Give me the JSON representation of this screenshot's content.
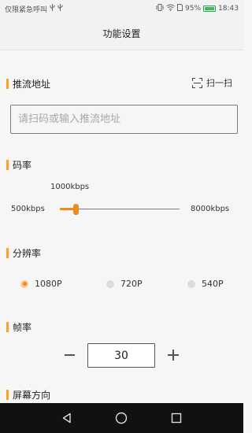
{
  "status_bar": {
    "carrier": "仅限紧急呼叫",
    "battery_percent": "95%",
    "time": "18:43",
    "colors": {
      "battery": "#33c05a"
    }
  },
  "header": {
    "title": "功能设置"
  },
  "push_url": {
    "title": "推流地址",
    "scan_label": "扫一扫",
    "placeholder": "请扫码或输入推流地址",
    "value": ""
  },
  "bitrate": {
    "title": "码率",
    "current_label": "1000kbps",
    "min_label": "500kbps",
    "max_label": "8000kbps",
    "value_kbps": 1000,
    "min_kbps": 500,
    "max_kbps": 8000
  },
  "resolution": {
    "title": "分辨率",
    "options": [
      {
        "label": "1080P",
        "selected": true
      },
      {
        "label": "720P",
        "selected": false
      },
      {
        "label": "540P",
        "selected": false
      }
    ]
  },
  "framerate": {
    "title": "帧率",
    "value": "30"
  },
  "orientation": {
    "title": "屏幕方向"
  },
  "theme": {
    "accent": "#f08a1c",
    "section_bar": "#f5a623",
    "nav_bar": "#111111"
  },
  "icons": {
    "vibrate": "vibrate-icon",
    "wifi": "wifi-icon",
    "sim": "sim-icon",
    "usb": "usb-icon",
    "scan": "scan-icon",
    "back": "back-triangle-icon",
    "home": "home-circle-icon",
    "recents": "recents-square-icon"
  }
}
